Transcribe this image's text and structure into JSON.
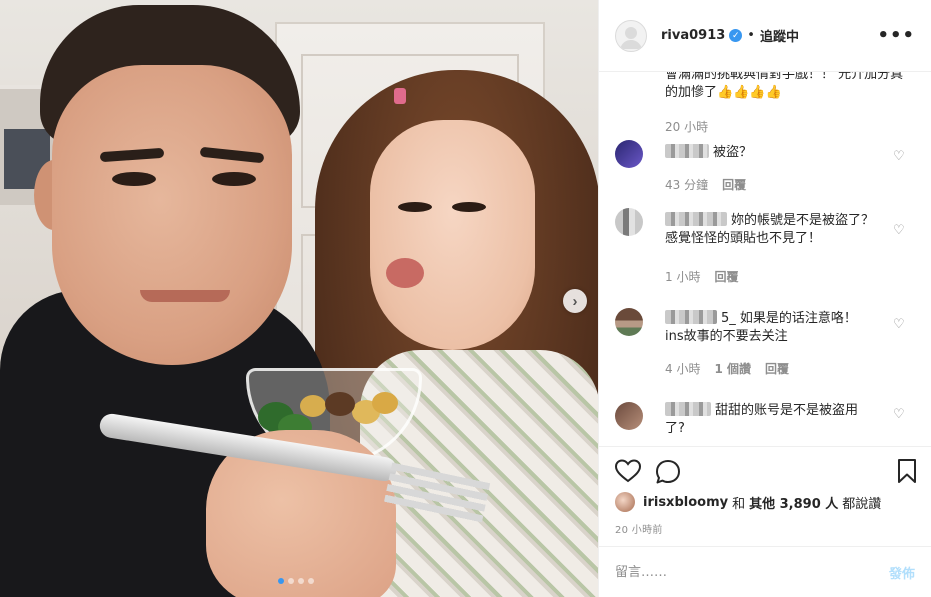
{
  "post": {
    "next_symbol": "›",
    "carousel_count": 4,
    "carousel_active": 1
  },
  "header": {
    "username": "riva0913",
    "separator": "•",
    "follow_label": "追蹤中",
    "more_symbol": "•••"
  },
  "caption": {
    "text": "會滿滿的挑戰與情對手戲！！ 光介加分真的加慘了👍👍👍👍",
    "time": "20 小時"
  },
  "comments": [
    {
      "text": "被盜？",
      "time": "43 分鐘",
      "reply": "回覆",
      "likes": ""
    },
    {
      "text": "妳的帳號是不是被盜了？感覺怪怪的頭貼也不見了！",
      "time": "1 小時",
      "reply": "回覆",
      "likes": ""
    },
    {
      "text": "5_ 如果是的话注意咯！ins故事的不要去关注",
      "time": "4 小時",
      "likes": "1 個讚",
      "reply": "回覆"
    },
    {
      "text": "甜甜的账号是不是被盗用了?",
      "time": "",
      "reply": "",
      "likes": ""
    }
  ],
  "likes": {
    "user": "irisxbloomy",
    "and": "和",
    "others": "其他 3,890 人",
    "suffix": "都說讚"
  },
  "posted_time": "20 小時前",
  "comment_box": {
    "placeholder": "留言……",
    "post_label": "發佈"
  },
  "colors": {
    "verified": "#3897f0",
    "post_button": "#b2dffc",
    "meta_text": "#8e8e8e",
    "active_dot": "#3897f0"
  },
  "icons": [
    "heart-icon",
    "comment-icon",
    "bookmark-icon",
    "verified-icon",
    "more-icon",
    "chevron-right-icon",
    "like-heart-icon"
  ]
}
